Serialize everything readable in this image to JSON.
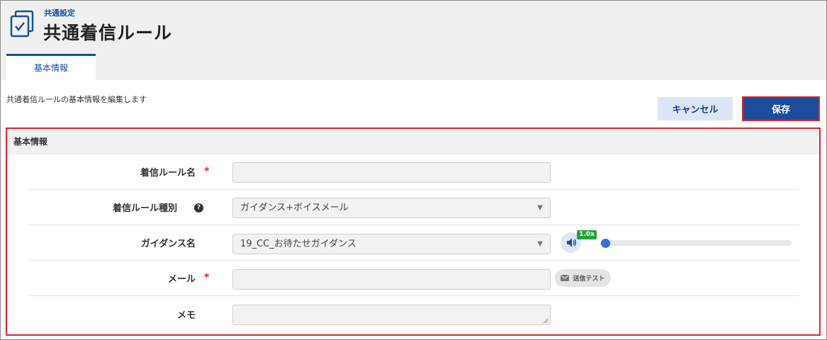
{
  "header": {
    "breadcrumb": "共通設定",
    "title": "共通着信ルール",
    "icon": "checkbox-document-icon"
  },
  "tabs": [
    {
      "label": "基本情報",
      "active": true
    }
  ],
  "description": "共通着信ルールの基本情報を編集します",
  "actions": {
    "cancel_label": "キャンセル",
    "save_label": "保存"
  },
  "section": {
    "title": "基本情報",
    "fields": {
      "rule_name": {
        "label": "着信ルール名",
        "required_mark": "*",
        "value": ""
      },
      "rule_type": {
        "label": "着信ルール種別",
        "help": "?",
        "value": "ガイダンス+ボイスメール"
      },
      "guidance": {
        "label": "ガイダンス名",
        "value": "19_CC_お待たせガイダンス",
        "playback_speed": "1.0x",
        "playback_progress": 0
      },
      "mail": {
        "label": "メール",
        "required_mark": "*",
        "value": "",
        "test_button_label": "送信テスト"
      },
      "memo": {
        "label": "メモ",
        "value": ""
      }
    }
  },
  "colors": {
    "accent": "#1a4fa0",
    "save_button": "#1c4c9c",
    "cancel_button": "#dce6f7",
    "highlight": "#d9282f",
    "speed_badge": "#22a538"
  }
}
